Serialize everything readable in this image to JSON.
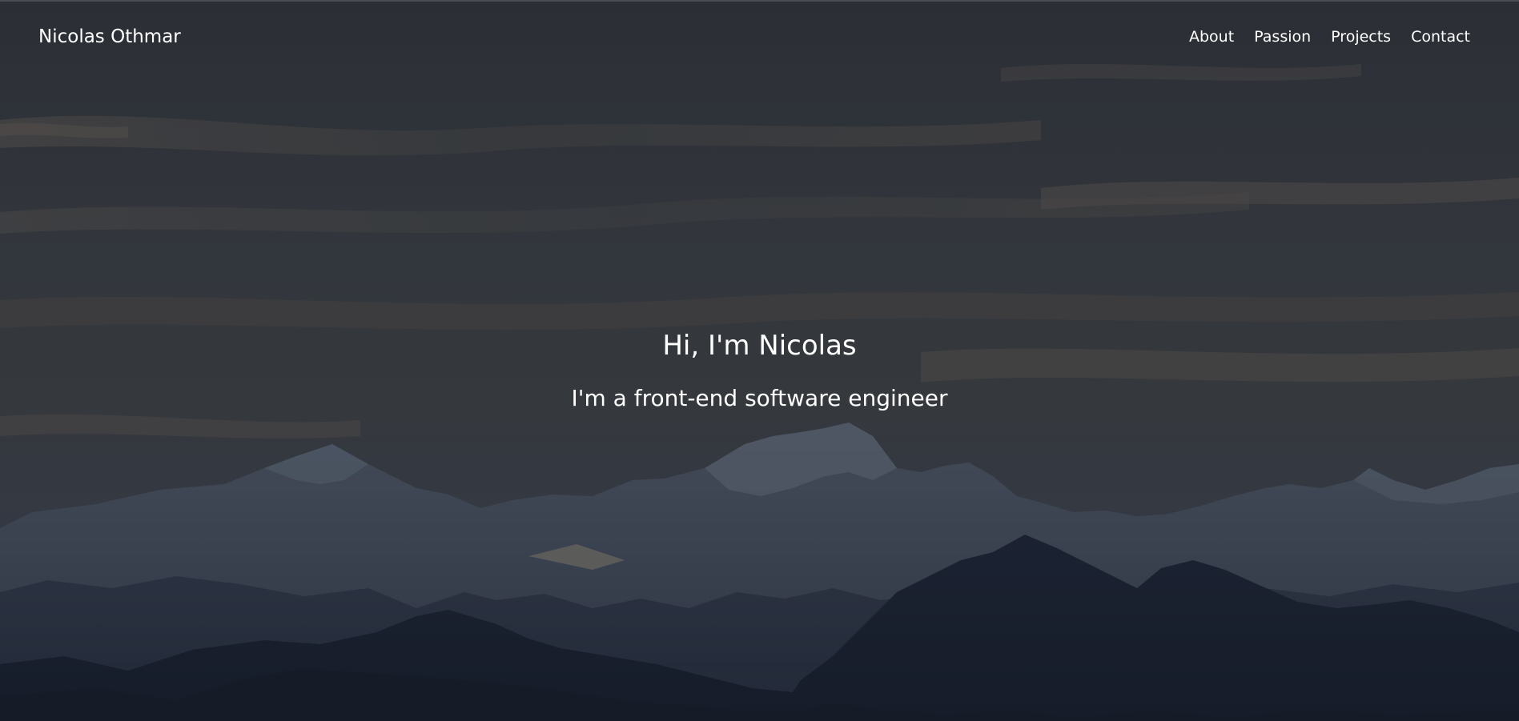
{
  "nav": {
    "brand": "Nicolas Othmar",
    "links": [
      {
        "label": "About"
      },
      {
        "label": "Passion"
      },
      {
        "label": "Projects"
      },
      {
        "label": "Contact"
      }
    ]
  },
  "hero": {
    "headline": "Hi, I'm Nicolas",
    "subheadline": "I'm a front-end software engineer",
    "background": "mountain-range-dusk-photo",
    "overlay_color": "#2b2f36"
  }
}
